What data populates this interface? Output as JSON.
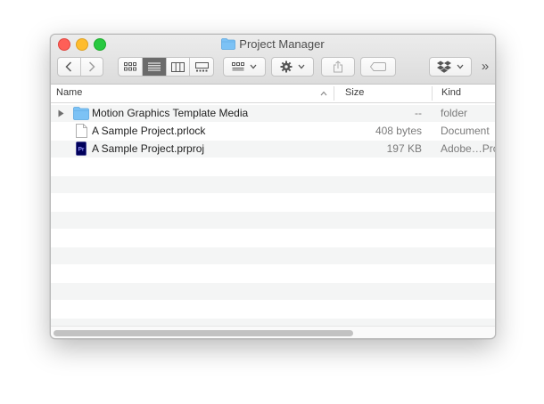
{
  "window": {
    "title": "Project Manager"
  },
  "toolbar": {
    "back_icon": "chevron-left-icon",
    "forward_icon": "chevron-right-icon",
    "view_modes": [
      "icon-view",
      "list-view",
      "column-view",
      "gallery-view"
    ],
    "active_view": "list-view",
    "overflow_label": "»"
  },
  "columns": {
    "name": "Name",
    "size": "Size",
    "kind": "Kind"
  },
  "files": [
    {
      "name": "Motion Graphics Template Media",
      "size": "--",
      "kind": "folder",
      "type": "folder"
    },
    {
      "name": "A Sample Project.prlock",
      "size": "408 bytes",
      "kind": "Document",
      "type": "document"
    },
    {
      "name": "A Sample Project.prproj",
      "size": "197 KB",
      "kind": "Adobe…Pro",
      "type": "premiere"
    }
  ],
  "colors": {
    "folder": "#7cc2f5",
    "premiere": "#00005b",
    "premiere_text": "#9999ff",
    "selected_view": "#6b6b6b"
  }
}
